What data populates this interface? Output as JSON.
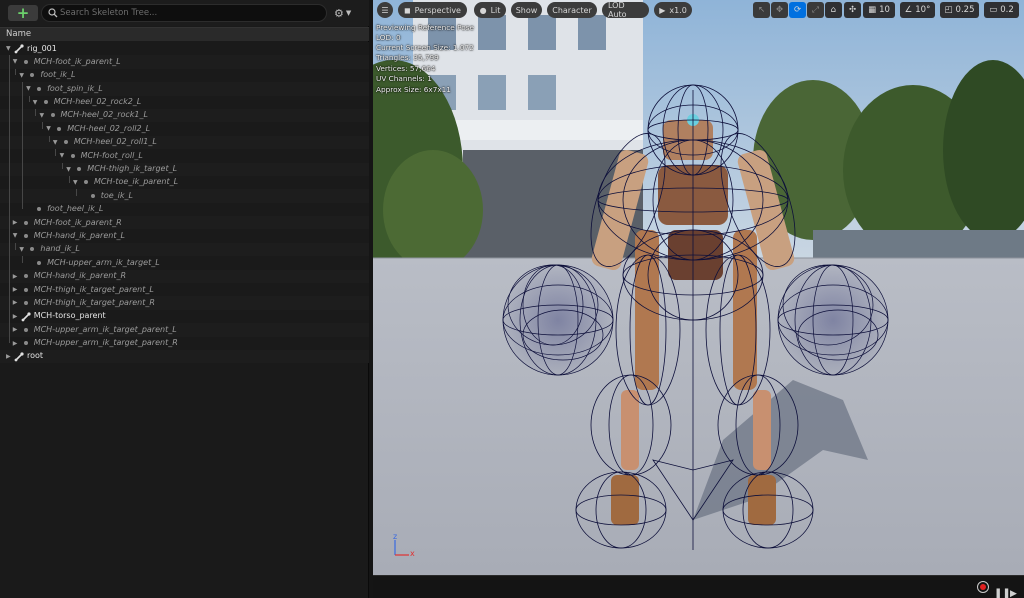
{
  "left_panel": {
    "add_label": "+",
    "search_placeholder": "Search Skeleton Tree...",
    "settings_glyph": "⚙",
    "column_header": "Name",
    "tree": [
      {
        "label": "rig_001",
        "depth": 0,
        "style": "bone",
        "expanded": true
      },
      {
        "label": "MCH-foot_ik_parent_L",
        "depth": 1,
        "style": "ital",
        "expanded": true
      },
      {
        "label": "foot_ik_L",
        "depth": 2,
        "style": "ital",
        "expanded": true
      },
      {
        "label": "foot_spin_ik_L",
        "depth": 3,
        "style": "ital",
        "expanded": true
      },
      {
        "label": "MCH-heel_02_rock2_L",
        "depth": 4,
        "style": "ital",
        "expanded": true
      },
      {
        "label": "MCH-heel_02_rock1_L",
        "depth": 5,
        "style": "ital",
        "expanded": true
      },
      {
        "label": "MCH-heel_02_roll2_L",
        "depth": 6,
        "style": "ital",
        "expanded": true
      },
      {
        "label": "MCH-heel_02_roll1_L",
        "depth": 7,
        "style": "ital",
        "expanded": true
      },
      {
        "label": "MCH-foot_roll_L",
        "depth": 8,
        "style": "ital",
        "expanded": true
      },
      {
        "label": "MCH-thigh_ik_target_L",
        "depth": 9,
        "style": "ital",
        "expanded": true
      },
      {
        "label": "MCH-toe_ik_parent_L",
        "depth": 10,
        "style": "ital",
        "expanded": true
      },
      {
        "label": "toe_ik_L",
        "depth": 11,
        "style": "ital",
        "expanded": null
      },
      {
        "label": "foot_heel_ik_L",
        "depth": 3,
        "style": "ital",
        "expanded": null
      },
      {
        "label": "MCH-foot_ik_parent_R",
        "depth": 1,
        "style": "ital",
        "expanded": false
      },
      {
        "label": "MCH-hand_ik_parent_L",
        "depth": 1,
        "style": "ital",
        "expanded": true
      },
      {
        "label": "hand_ik_L",
        "depth": 2,
        "style": "ital",
        "expanded": true
      },
      {
        "label": "MCH-upper_arm_ik_target_L",
        "depth": 3,
        "style": "ital",
        "expanded": null
      },
      {
        "label": "MCH-hand_ik_parent_R",
        "depth": 1,
        "style": "ital",
        "expanded": false
      },
      {
        "label": "MCH-thigh_ik_target_parent_L",
        "depth": 1,
        "style": "ital",
        "expanded": false
      },
      {
        "label": "MCH-thigh_ik_target_parent_R",
        "depth": 1,
        "style": "ital",
        "expanded": false
      },
      {
        "label": "MCH-torso_parent",
        "depth": 1,
        "style": "bone",
        "expanded": false
      },
      {
        "label": "MCH-upper_arm_ik_target_parent_L",
        "depth": 1,
        "style": "ital",
        "expanded": false
      },
      {
        "label": "MCH-upper_arm_ik_target_parent_R",
        "depth": 1,
        "style": "ital",
        "expanded": false
      },
      {
        "label": "root",
        "depth": 0,
        "style": "bone",
        "expanded": false
      }
    ]
  },
  "viewport": {
    "menu_glyph": "☰",
    "perspective_label": "Perspective",
    "lit_label": "Lit",
    "show_label": "Show",
    "character_label": "Character",
    "lod_label": "LOD Auto",
    "play_label": "x1.0",
    "grid_snap_value": "10",
    "rotation_snap_value": "10°",
    "scale_snap_value": "0.25",
    "camera_speed_value": "0.2",
    "info_lines": [
      "Previewing Reference Pose",
      "LOD: 0",
      "Current Screen Size: 1.072",
      "Triangles: 35,799",
      "Vertices: 57,664",
      "UV Channels: 1",
      "Approx Size: 6x7x11"
    ],
    "axis_z": "z",
    "axis_x": "x"
  },
  "colors": {
    "accent_blue": "#0070e0",
    "add_green": "#6cd16c",
    "record_red": "#e02020",
    "wire": "#0d0f3a"
  }
}
